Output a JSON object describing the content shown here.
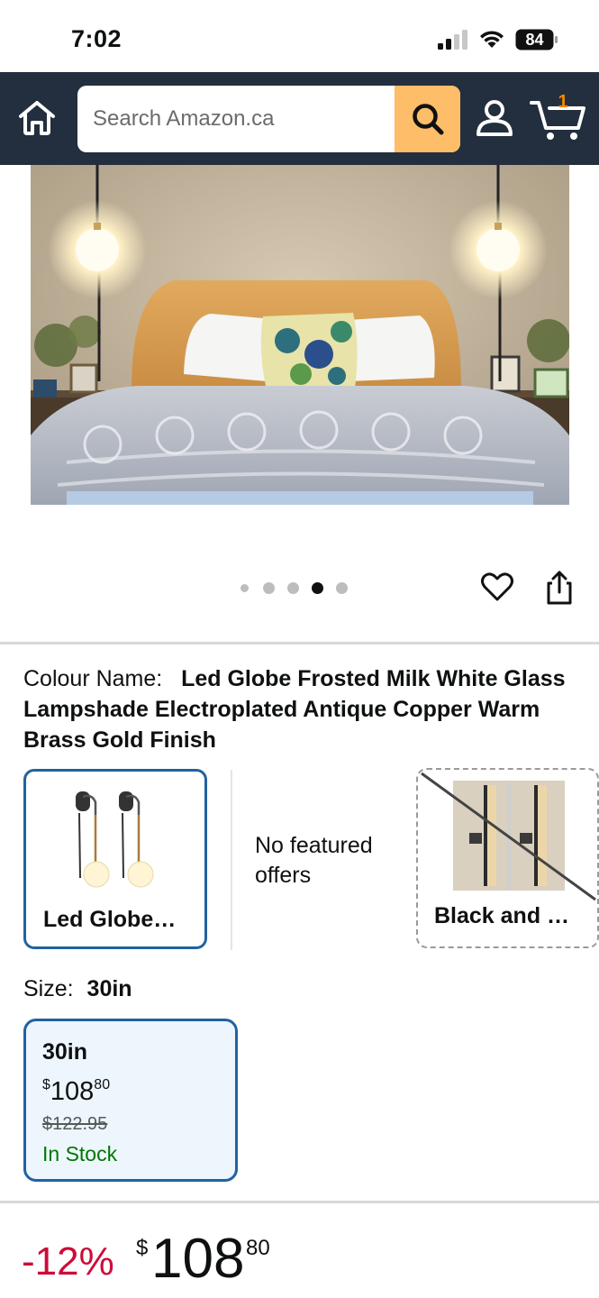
{
  "status_bar": {
    "time": "7:02",
    "battery": "84"
  },
  "header": {
    "search_placeholder": "Search Amazon.ca",
    "cart_count": "1"
  },
  "gallery": {
    "image_count": 5,
    "active_index": 3
  },
  "colour": {
    "label": "Colour Name:",
    "value": "Led Globe Frosted Milk White Glass Lampshade Electroplated Antique Copper Warm Brass Gold Finish",
    "swatches": [
      {
        "name": "Led Globe Frosted Milk White Glass Lampshade Electroplated Antique Copper Warm Brass Gold Finish",
        "display": "Led Globe…",
        "selected": true
      },
      {
        "name": "Black and …",
        "display": "Black and …",
        "available": false
      }
    ],
    "no_featured_offers": "No featured offers"
  },
  "size": {
    "label": "Size:",
    "value": "30in",
    "options": [
      {
        "name": "30in",
        "price_symbol": "$",
        "price_whole": "108",
        "price_fraction": "80",
        "list_price": "$122.95",
        "availability": "In Stock"
      }
    ]
  },
  "price": {
    "discount": "-12%",
    "symbol": "$",
    "whole": "108",
    "fraction": "80"
  },
  "colors": {
    "header_bg": "#232f3e",
    "search_button": "#febd69",
    "selected_border": "#2162a1",
    "discount_red": "#cc0c39",
    "in_stock_green": "#007600",
    "cart_count": "#f08804"
  }
}
